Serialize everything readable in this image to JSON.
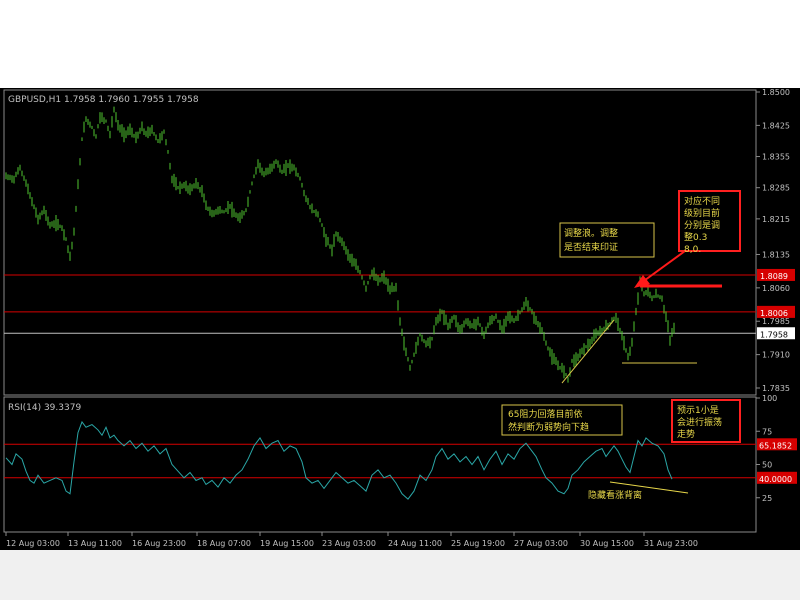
{
  "colors": {
    "background": "#000000",
    "candles": "#4fc630",
    "rsi_line": "#2aa6a6",
    "level_line": "#d60000",
    "current_line": "#c0c0c0",
    "axis_text": "#c0c0c0",
    "annotation_border": "#d8c34a",
    "annotation_text": "#e8d84a",
    "red_box_border": "#ff2020",
    "arrow": "#ff1a1a"
  },
  "header": {
    "symbol_info": "GBPUSD,H1  1.7958  1.7960  1.7955  1.7958",
    "rsi_info": "RSI(14)  39.3379"
  },
  "price_axis": {
    "ticks": [
      "1.8500",
      "1.8425",
      "1.8355",
      "1.8285",
      "1.8215",
      "1.8135",
      "1.8060",
      "1.7985",
      "1.7910",
      "1.7835"
    ],
    "levels": [
      {
        "label": "1.8089",
        "value": 1.8089
      },
      {
        "label": "1.8006",
        "value": 1.8006
      }
    ],
    "current": {
      "label": "1.7958",
      "value": 1.7958
    }
  },
  "rsi_axis": {
    "ticks": [
      "100",
      "75",
      "50",
      "25"
    ],
    "levels": [
      {
        "label": "65.1852",
        "value": 65.1852
      },
      {
        "label": "40.0000",
        "value": 40.0
      }
    ]
  },
  "time_axis": {
    "labels": [
      "12 Aug 03:00",
      "13 Aug 11:00",
      "16 Aug 23:00",
      "18 Aug 07:00",
      "19 Aug 15:00",
      "23 Aug 03:00",
      "24 Aug 11:00",
      "25 Aug 19:00",
      "27 Aug 03:00",
      "30 Aug 15:00",
      "31 Aug 23:00"
    ]
  },
  "annotations": {
    "correction_note": "调整浪。调整是否结束印证",
    "level_note": "对应不同级别目前分别是调整0.38,0.5",
    "resistance_note": "65阻力回落目前依然判断为弱势向下趋势",
    "divergence_note": "隐藏看涨背离",
    "oscillation_note": "预示1小是会进行振荡走势"
  },
  "chart_data": [
    {
      "type": "candlestick",
      "title": "GBPUSD,H1",
      "ohlc_header": [
        1.7958,
        1.796,
        1.7955,
        1.7958
      ],
      "x_labels": [
        "12 Aug 03:00",
        "13 Aug 11:00",
        "16 Aug 23:00",
        "18 Aug 07:00",
        "19 Aug 15:00",
        "23 Aug 03:00",
        "24 Aug 11:00",
        "25 Aug 19:00",
        "27 Aug 03:00",
        "30 Aug 15:00",
        "31 Aug 23:00"
      ],
      "ylim": [
        1.7835,
        1.85
      ],
      "grid": false,
      "close_path": [
        [
          0,
          1.831
        ],
        [
          8,
          1.8305
        ],
        [
          14,
          1.833
        ],
        [
          20,
          1.8295
        ],
        [
          25,
          1.826
        ],
        [
          32,
          1.8215
        ],
        [
          38,
          1.8235
        ],
        [
          44,
          1.82
        ],
        [
          50,
          1.8205
        ],
        [
          56,
          1.8195
        ],
        [
          60,
          1.817
        ],
        [
          64,
          1.813
        ],
        [
          68,
          1.8185
        ],
        [
          72,
          1.829
        ],
        [
          76,
          1.8395
        ],
        [
          80,
          1.844
        ],
        [
          85,
          1.8425
        ],
        [
          90,
          1.84
        ],
        [
          94,
          1.8445
        ],
        [
          100,
          1.8435
        ],
        [
          104,
          1.8405
        ],
        [
          108,
          1.846
        ],
        [
          112,
          1.8425
        ],
        [
          118,
          1.8405
        ],
        [
          124,
          1.8415
        ],
        [
          130,
          1.8395
        ],
        [
          136,
          1.842
        ],
        [
          140,
          1.8405
        ],
        [
          146,
          1.8415
        ],
        [
          152,
          1.839
        ],
        [
          158,
          1.841
        ],
        [
          162,
          1.8365
        ],
        [
          166,
          1.8305
        ],
        [
          172,
          1.8285
        ],
        [
          178,
          1.829
        ],
        [
          184,
          1.828
        ],
        [
          190,
          1.8295
        ],
        [
          196,
          1.8275
        ],
        [
          200,
          1.8245
        ],
        [
          206,
          1.8225
        ],
        [
          212,
          1.8235
        ],
        [
          218,
          1.823
        ],
        [
          224,
          1.8245
        ],
        [
          228,
          1.8225
        ],
        [
          234,
          1.8215
        ],
        [
          240,
          1.8235
        ],
        [
          246,
          1.8295
        ],
        [
          252,
          1.834
        ],
        [
          258,
          1.8315
        ],
        [
          264,
          1.8325
        ],
        [
          270,
          1.8345
        ],
        [
          276,
          1.832
        ],
        [
          282,
          1.8335
        ],
        [
          288,
          1.833
        ],
        [
          294,
          1.8305
        ],
        [
          300,
          1.826
        ],
        [
          306,
          1.8235
        ],
        [
          312,
          1.8225
        ],
        [
          316,
          1.82
        ],
        [
          320,
          1.817
        ],
        [
          326,
          1.8145
        ],
        [
          330,
          1.818
        ],
        [
          336,
          1.8165
        ],
        [
          342,
          1.8135
        ],
        [
          348,
          1.8115
        ],
        [
          354,
          1.8095
        ],
        [
          360,
          1.806
        ],
        [
          366,
          1.8095
        ],
        [
          372,
          1.8075
        ],
        [
          378,
          1.8085
        ],
        [
          384,
          1.8055
        ],
        [
          390,
          1.806
        ],
        [
          394,
          1.7985
        ],
        [
          398,
          1.7935
        ],
        [
          404,
          1.788
        ],
        [
          410,
          1.7925
        ],
        [
          414,
          1.7955
        ],
        [
          420,
          1.7935
        ],
        [
          426,
          1.7945
        ],
        [
          430,
          1.7985
        ],
        [
          436,
          1.8005
        ],
        [
          442,
          1.7975
        ],
        [
          448,
          1.7995
        ],
        [
          454,
          1.7965
        ],
        [
          460,
          1.7985
        ],
        [
          466,
          1.7975
        ],
        [
          472,
          1.7985
        ],
        [
          478,
          1.7955
        ],
        [
          484,
          1.7985
        ],
        [
          490,
          1.7995
        ],
        [
          496,
          1.7965
        ],
        [
          502,
          1.8
        ],
        [
          508,
          1.7985
        ],
        [
          514,
          1.8005
        ],
        [
          520,
          1.8025
        ],
        [
          526,
          1.8005
        ],
        [
          530,
          1.7985
        ],
        [
          536,
          1.7965
        ],
        [
          540,
          1.7935
        ],
        [
          546,
          1.7905
        ],
        [
          552,
          1.7885
        ],
        [
          558,
          1.7875
        ],
        [
          562,
          1.7855
        ],
        [
          566,
          1.7895
        ],
        [
          572,
          1.7905
        ],
        [
          578,
          1.7925
        ],
        [
          584,
          1.7935
        ],
        [
          590,
          1.7955
        ],
        [
          596,
          1.7965
        ],
        [
          602,
          1.7975
        ],
        [
          606,
          1.7985
        ],
        [
          610,
          1.7995
        ],
        [
          614,
          1.7965
        ],
        [
          618,
          1.7935
        ],
        [
          622,
          1.7905
        ],
        [
          626,
          1.7935
        ],
        [
          630,
          1.8005
        ],
        [
          634,
          1.8075
        ],
        [
          638,
          1.8045
        ],
        [
          642,
          1.8055
        ],
        [
          646,
          1.8035
        ],
        [
          650,
          1.8045
        ],
        [
          656,
          1.8035
        ],
        [
          660,
          1.7995
        ],
        [
          664,
          1.7945
        ],
        [
          668,
          1.797
        ]
      ],
      "horizontal_levels": [
        1.8089,
        1.8006
      ],
      "current_price": 1.7958
    },
    {
      "type": "line",
      "title": "RSI(14)",
      "value_header": 39.3379,
      "ylim": [
        0,
        100
      ],
      "levels": [
        65.1852,
        40.0
      ],
      "series": [
        {
          "path": [
            [
              0,
              55
            ],
            [
              6,
              50
            ],
            [
              10,
              58
            ],
            [
              16,
              54
            ],
            [
              20,
              45
            ],
            [
              24,
              38
            ],
            [
              28,
              36
            ],
            [
              32,
              42
            ],
            [
              38,
              36
            ],
            [
              44,
              38
            ],
            [
              50,
              40
            ],
            [
              56,
              38
            ],
            [
              60,
              30
            ],
            [
              64,
              28
            ],
            [
              68,
              52
            ],
            [
              72,
              74
            ],
            [
              76,
              82
            ],
            [
              80,
              78
            ],
            [
              86,
              80
            ],
            [
              92,
              76
            ],
            [
              96,
              72
            ],
            [
              100,
              78
            ],
            [
              104,
              70
            ],
            [
              108,
              72
            ],
            [
              112,
              68
            ],
            [
              118,
              64
            ],
            [
              124,
              68
            ],
            [
              130,
              62
            ],
            [
              136,
              66
            ],
            [
              142,
              60
            ],
            [
              148,
              64
            ],
            [
              154,
              58
            ],
            [
              160,
              62
            ],
            [
              166,
              50
            ],
            [
              172,
              45
            ],
            [
              178,
              40
            ],
            [
              184,
              44
            ],
            [
              190,
              38
            ],
            [
              196,
              40
            ],
            [
              200,
              35
            ],
            [
              206,
              38
            ],
            [
              212,
              33
            ],
            [
              218,
              40
            ],
            [
              224,
              36
            ],
            [
              230,
              42
            ],
            [
              236,
              46
            ],
            [
              242,
              54
            ],
            [
              248,
              64
            ],
            [
              254,
              70
            ],
            [
              260,
              62
            ],
            [
              266,
              66
            ],
            [
              272,
              68
            ],
            [
              278,
              60
            ],
            [
              284,
              64
            ],
            [
              290,
              62
            ],
            [
              296,
              52
            ],
            [
              300,
              40
            ],
            [
              306,
              36
            ],
            [
              312,
              38
            ],
            [
              318,
              32
            ],
            [
              324,
              38
            ],
            [
              330,
              44
            ],
            [
              336,
              40
            ],
            [
              342,
              36
            ],
            [
              348,
              38
            ],
            [
              354,
              34
            ],
            [
              360,
              30
            ],
            [
              366,
              42
            ],
            [
              372,
              46
            ],
            [
              378,
              40
            ],
            [
              384,
              42
            ],
            [
              390,
              36
            ],
            [
              396,
              28
            ],
            [
              402,
              24
            ],
            [
              408,
              30
            ],
            [
              414,
              42
            ],
            [
              420,
              38
            ],
            [
              426,
              46
            ],
            [
              430,
              56
            ],
            [
              436,
              62
            ],
            [
              442,
              54
            ],
            [
              448,
              58
            ],
            [
              454,
              52
            ],
            [
              460,
              56
            ],
            [
              466,
              50
            ],
            [
              472,
              56
            ],
            [
              478,
              46
            ],
            [
              484,
              54
            ],
            [
              490,
              60
            ],
            [
              496,
              50
            ],
            [
              502,
              58
            ],
            [
              508,
              54
            ],
            [
              514,
              62
            ],
            [
              520,
              66
            ],
            [
              526,
              60
            ],
            [
              530,
              56
            ],
            [
              536,
              46
            ],
            [
              540,
              40
            ],
            [
              546,
              36
            ],
            [
              552,
              30
            ],
            [
              558,
              28
            ],
            [
              562,
              32
            ],
            [
              566,
              42
            ],
            [
              572,
              46
            ],
            [
              578,
              52
            ],
            [
              584,
              56
            ],
            [
              590,
              60
            ],
            [
              596,
              62
            ],
            [
              600,
              56
            ],
            [
              604,
              60
            ],
            [
              608,
              64
            ],
            [
              612,
              60
            ],
            [
              616,
              54
            ],
            [
              620,
              48
            ],
            [
              624,
              44
            ],
            [
              628,
              56
            ],
            [
              632,
              68
            ],
            [
              636,
              64
            ],
            [
              640,
              70
            ],
            [
              646,
              66
            ],
            [
              652,
              64
            ],
            [
              658,
              58
            ],
            [
              662,
              46
            ],
            [
              666,
              39
            ]
          ]
        }
      ]
    }
  ]
}
